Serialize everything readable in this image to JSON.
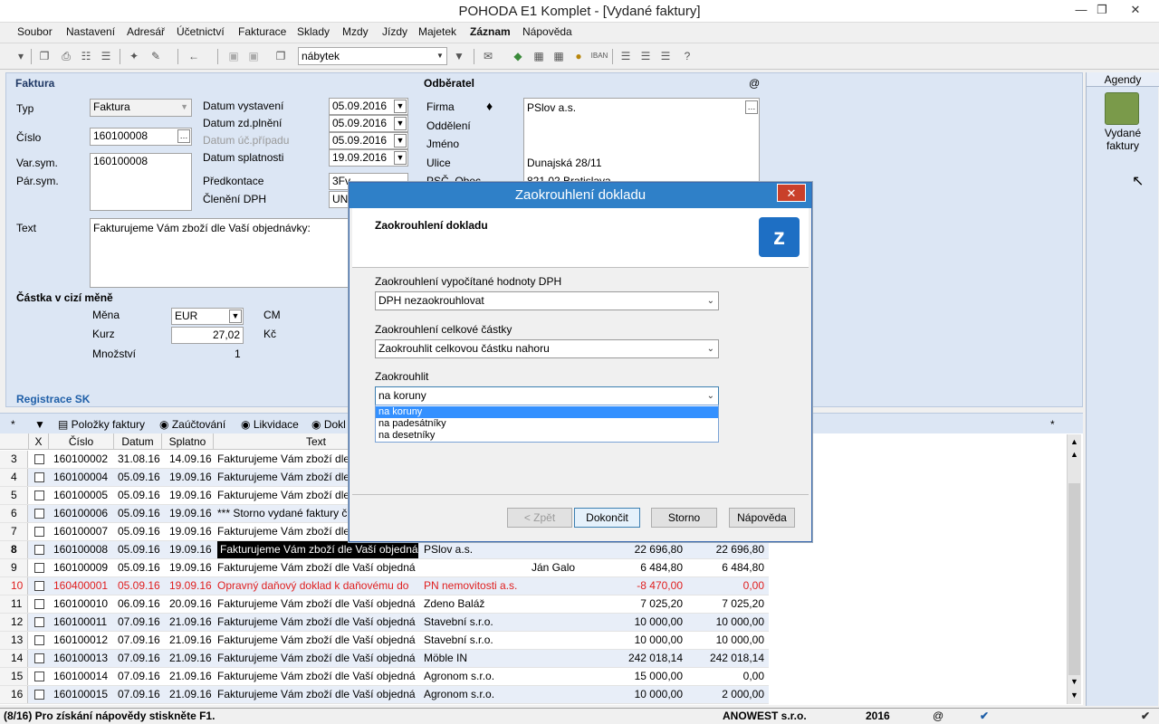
{
  "window": {
    "title": "POHODA E1 Komplet - [Vydané faktury]"
  },
  "menu": [
    "Soubor",
    "Nastavení",
    "Adresář",
    "Účetnictví",
    "Fakturace",
    "Sklady",
    "Mzdy",
    "Jízdy",
    "Majetek",
    "Záznam",
    "Nápověda"
  ],
  "toolbar": {
    "filter_value": "nábytek"
  },
  "form": {
    "section_faktura": "Faktura",
    "typ_label": "Typ",
    "typ_value": "Faktura",
    "cislo_label": "Číslo",
    "cislo_value": "160100008",
    "varsym_label": "Var.sym.",
    "varsym_value": "160100008",
    "parsym_label": "Pár.sym.",
    "datum_vystaveni_label": "Datum vystavení",
    "datum_vystaveni": "05.09.2016",
    "datum_zdpl_label": "Datum zd.plnění",
    "datum_zdpl": "05.09.2016",
    "datum_ucpr_label": "Datum úč.případu",
    "datum_ucpr": "05.09.2016",
    "datum_splat_label": "Datum splatnosti",
    "datum_splat": "19.09.2016",
    "predkontace_label": "Předkontace",
    "predkontace": "3Fv",
    "cleneni_label": "Členění DPH",
    "cleneni": "UN",
    "text_label": "Text",
    "text_value": "Fakturujeme Vám zboží dle Vaší objednávky:",
    "castka_header": "Částka v cizí měně",
    "mena_label": "Měna",
    "mena": "EUR",
    "kurz_label": "Kurz",
    "kurz": "27,02",
    "mnozstvi_label": "Množství",
    "mnozstvi": "1",
    "cm_label": "CM",
    "kc_label": "Kč",
    "registrace": "Registrace SK",
    "odberatel_header": "Odběratel",
    "at_sign": "@",
    "firma_label": "Firma",
    "firma": "PSlov a.s.",
    "oddeleni_label": "Oddělení",
    "jmeno_label": "Jméno",
    "ulice_label": "Ulice",
    "ulice": "Dunajská  28/11",
    "psc_label": "PSČ, Obec",
    "psc": "821 02   Bratislava"
  },
  "agendy": {
    "header": "Agendy",
    "item_line1": "Vydané",
    "item_line2": "faktury"
  },
  "tabs": [
    {
      "label": "Položky faktury"
    },
    {
      "label": "Zaúčtování"
    },
    {
      "label": "Likvidace"
    },
    {
      "label": "Dokl"
    }
  ],
  "table": {
    "columns": [
      "X",
      "Číslo",
      "Datum",
      "Splatno",
      "Text"
    ],
    "rows": [
      {
        "n": "3",
        "cislo": "160100002",
        "datum": "31.08.16",
        "splatno": "14.09.16",
        "text": "Fakturujeme Vám zboží dle",
        "firma": "",
        "jmeno": "",
        "castka": "",
        "zbyva": ""
      },
      {
        "n": "4",
        "cislo": "160100004",
        "datum": "05.09.16",
        "splatno": "19.09.16",
        "text": "Fakturujeme Vám zboží dle",
        "firma": "",
        "jmeno": "",
        "castka": "",
        "zbyva": ""
      },
      {
        "n": "5",
        "cislo": "160100005",
        "datum": "05.09.16",
        "splatno": "19.09.16",
        "text": "Fakturujeme Vám zboží dle",
        "firma": "",
        "jmeno": "",
        "castka": "",
        "zbyva": ""
      },
      {
        "n": "6",
        "cislo": "160100006",
        "datum": "05.09.16",
        "splatno": "19.09.16",
        "text": "*** Storno vydané faktury č",
        "firma": "",
        "jmeno": "",
        "castka": "",
        "zbyva": ""
      },
      {
        "n": "7",
        "cislo": "160100007",
        "datum": "05.09.16",
        "splatno": "19.09.16",
        "text": "Fakturujeme Vám zboží dle",
        "firma": "",
        "jmeno": "",
        "castka": "",
        "zbyva": ""
      },
      {
        "n": "8",
        "cislo": "160100008",
        "datum": "05.09.16",
        "splatno": "19.09.16",
        "text": "Fakturujeme Vám zboží dle Vaší objedná",
        "firma": "PSlov a.s.",
        "jmeno": "",
        "castka": "22 696,80",
        "zbyva": "22 696,80"
      },
      {
        "n": "9",
        "cislo": "160100009",
        "datum": "05.09.16",
        "splatno": "19.09.16",
        "text": "Fakturujeme Vám zboží dle Vaší objedná",
        "firma": "",
        "jmeno": "Ján Galo",
        "castka": "6 484,80",
        "zbyva": "6 484,80"
      },
      {
        "n": "10",
        "cislo": "160400001",
        "datum": "05.09.16",
        "splatno": "19.09.16",
        "text": "Opravný daňový doklad k daňovému do",
        "firma": "PN nemovitosti a.s.",
        "jmeno": "",
        "castka": "-8 470,00",
        "zbyva": "0,00"
      },
      {
        "n": "11",
        "cislo": "160100010",
        "datum": "06.09.16",
        "splatno": "20.09.16",
        "text": "Fakturujeme Vám zboží dle Vaší objedná",
        "firma": "Zdeno Baláž",
        "jmeno": "",
        "castka": "7 025,20",
        "zbyva": "7 025,20"
      },
      {
        "n": "12",
        "cislo": "160100011",
        "datum": "07.09.16",
        "splatno": "21.09.16",
        "text": "Fakturujeme Vám zboží dle Vaší objedná",
        "firma": "Stavební s.r.o.",
        "jmeno": "",
        "castka": "10 000,00",
        "zbyva": "10 000,00"
      },
      {
        "n": "13",
        "cislo": "160100012",
        "datum": "07.09.16",
        "splatno": "21.09.16",
        "text": "Fakturujeme Vám zboží dle Vaší objedná",
        "firma": "Stavební s.r.o.",
        "jmeno": "",
        "castka": "10 000,00",
        "zbyva": "10 000,00"
      },
      {
        "n": "14",
        "cislo": "160100013",
        "datum": "07.09.16",
        "splatno": "21.09.16",
        "text": "Fakturujeme Vám zboží dle Vaší objedná",
        "firma": "Möble IN",
        "jmeno": "",
        "castka": "242 018,14",
        "zbyva": "242 018,14"
      },
      {
        "n": "15",
        "cislo": "160100014",
        "datum": "07.09.16",
        "splatno": "21.09.16",
        "text": "Fakturujeme Vám zboží dle Vaší objedná",
        "firma": "Agronom s.r.o.",
        "jmeno": "",
        "castka": "15 000,00",
        "zbyva": "0,00"
      },
      {
        "n": "16",
        "cislo": "160100015",
        "datum": "07.09.16",
        "splatno": "21.09.16",
        "text": "Fakturujeme Vám zboží dle Vaší objedná",
        "firma": "Agronom s.r.o.",
        "jmeno": "",
        "castka": "10 000,00",
        "zbyva": "2 000,00"
      }
    ]
  },
  "status": {
    "help": "(8/16) Pro získání nápovědy stiskněte F1.",
    "company": "ANOWEST s.r.o.",
    "year": "2016",
    "at": "@"
  },
  "dialog": {
    "title": "Zaokrouhlení dokladu",
    "header": "Zaokrouhlení dokladu",
    "dph_label": "Zaokrouhlení vypočítané hodnoty DPH",
    "dph_value": "DPH nezaokrouhlovat",
    "total_label": "Zaokrouhlení celkové částky",
    "total_value": "Zaokrouhlit celkovou částku nahoru",
    "round_label": "Zaokrouhlit",
    "round_value": "na koruny",
    "options": [
      "na koruny",
      "na padesátníky",
      "na desetníky"
    ],
    "buttons": {
      "back": "< Zpět",
      "finish": "Dokončit",
      "cancel": "Storno",
      "help": "Nápověda"
    }
  }
}
